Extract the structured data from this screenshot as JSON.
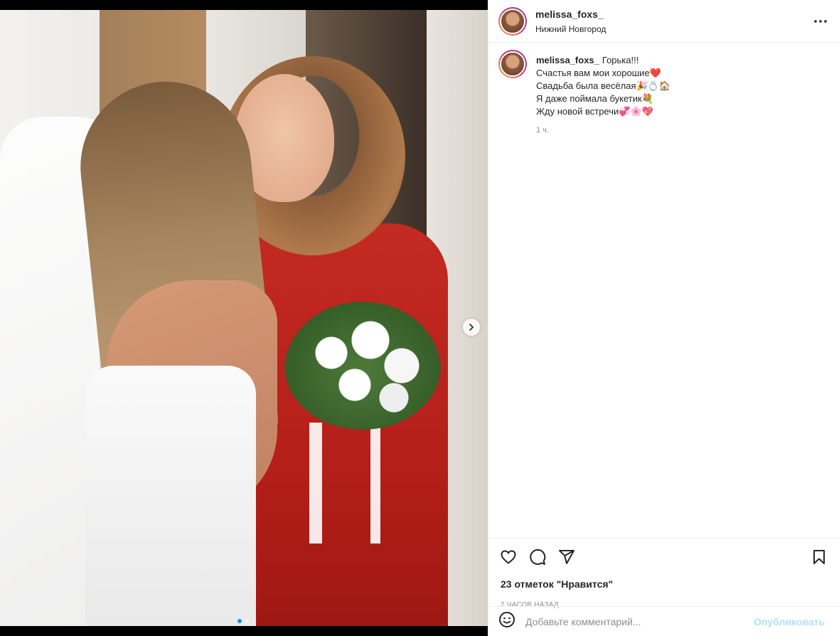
{
  "post": {
    "username": "melissa_foxs_",
    "location": "Нижний Новгород",
    "caption_lead": "Горька!!!",
    "caption_lines": [
      {
        "text": "Счастья вам мои хорошие",
        "emoji": "❤️"
      },
      {
        "text": "Свадьба была весёлая",
        "emoji": "🎉💍🏠"
      },
      {
        "text": "Я даже поймала букетик",
        "emoji": "💐"
      },
      {
        "text": "Жду новой встречи",
        "emoji": "💞🌸💖"
      }
    ],
    "caption_time": "1 ч.",
    "likes": "23 отметок \"Нравится\"",
    "post_time": "2 часов назад"
  },
  "comment": {
    "placeholder": "Добавьте комментарий...",
    "publish_label": "Опубликовать"
  },
  "carousel": {
    "slides": 2,
    "active": 1
  },
  "icons": {
    "more": "more-horizontal-icon",
    "like": "heart-icon",
    "comment": "comment-icon",
    "share": "paper-plane-icon",
    "save": "bookmark-icon",
    "emoji": "smiley-icon",
    "next": "chevron-right-icon"
  },
  "colors": {
    "accent": "#0095f6",
    "publish_disabled": "#b2dffc",
    "muted": "#8e8e8e"
  }
}
